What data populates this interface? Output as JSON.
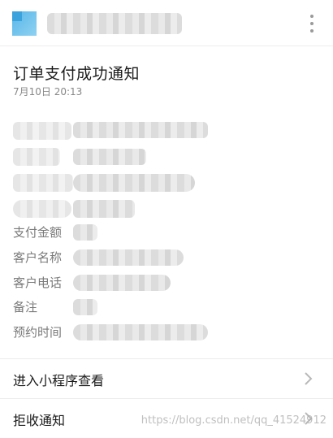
{
  "notification": {
    "title": "订单支付成功通知",
    "timestamp": "7月10日  20:13"
  },
  "fields": [
    {
      "label": "支付金额"
    },
    {
      "label": "客户名称"
    },
    {
      "label": "客户电话"
    },
    {
      "label": "备注"
    },
    {
      "label": "预约时间"
    }
  ],
  "actions": [
    {
      "label": "进入小程序查看",
      "icon": "chevron-right-icon"
    },
    {
      "label": "拒收通知",
      "icon": "chevron-right-icon"
    }
  ],
  "watermark": "https://blog.csdn.net/qq_41524912",
  "icons": {
    "header_menu": "more-vertical-icon"
  },
  "colors": {
    "title": "#1a1a1a",
    "label": "#7a7a7a",
    "timestamp": "#888888",
    "divider": "#ececec",
    "avatar": "#57b7e8"
  }
}
